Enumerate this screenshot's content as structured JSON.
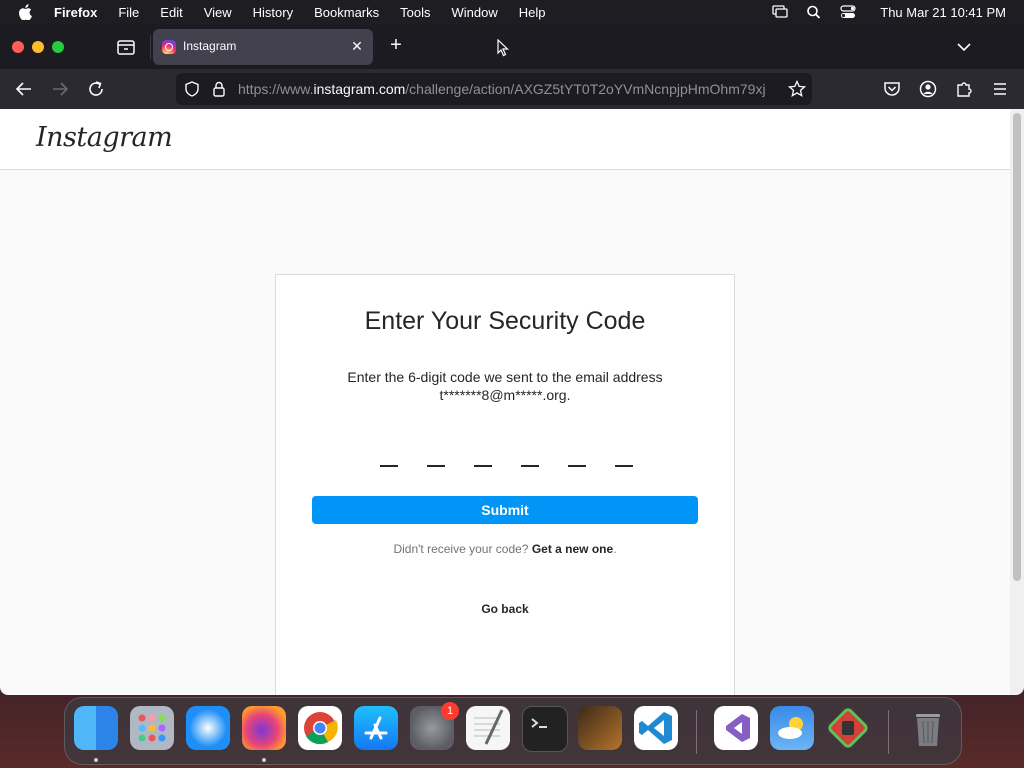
{
  "menubar": {
    "app_name": "Firefox",
    "items": [
      "File",
      "Edit",
      "View",
      "History",
      "Bookmarks",
      "Tools",
      "Window",
      "Help"
    ],
    "clock": "Thu Mar 21  10:41 PM"
  },
  "browser": {
    "tab": {
      "title": "Instagram"
    },
    "url": {
      "scheme": "https://www.",
      "host": "instagram.com",
      "path": "/challenge/action/AXGZ5tYT0T2oYVmNcnpjpHmOhm79xj"
    }
  },
  "page": {
    "logo_text": "Instagram",
    "heading": "Enter Your Security Code",
    "description_line1": "Enter the 6-digit code we sent to the email address",
    "description_line2": "t*******8@m*****.org.",
    "submit_label": "Submit",
    "resend_prefix": "Didn't receive your code?",
    "resend_link": "Get a new one",
    "resend_suffix": ".",
    "go_back_label": "Go back"
  },
  "dock": {
    "apps": [
      "finder",
      "launchpad",
      "safari",
      "firefox",
      "chrome",
      "app-store",
      "system-settings",
      "textedit",
      "terminal",
      "garageband",
      "vscode",
      "visual-studio",
      "weather",
      "game-app",
      "trash"
    ],
    "settings_badge": "1"
  },
  "colors": {
    "accent": "#0095f6",
    "page_bg": "#fafafa",
    "window_chrome": "#1c1b22",
    "toolbar": "#2b2a33"
  }
}
